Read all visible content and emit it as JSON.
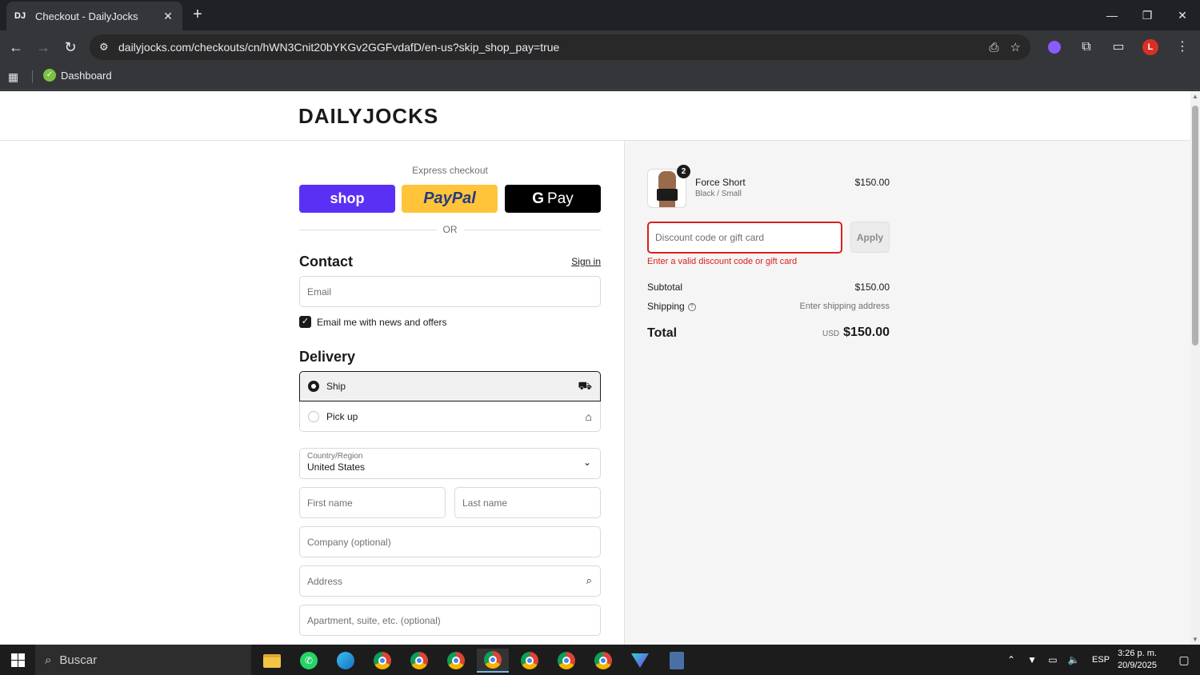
{
  "browser": {
    "tab": {
      "favicon": "DJ",
      "title": "Checkout - DailyJocks",
      "close": "✕"
    },
    "new_tab": "+",
    "window_controls": {
      "minimize": "—",
      "maximize": "❐",
      "close": "✕"
    },
    "url": "dailyjocks.com/checkouts/cn/hWN3Cnit20bYKGv2GGFvdafD/en-us?skip_shop_pay=true",
    "bookmarks": [
      {
        "label": "Dashboard"
      }
    ],
    "profile_initial": "L"
  },
  "site": {
    "logo": "DAILYJOCKS"
  },
  "checkout": {
    "express_label": "Express checkout",
    "express_buttons": {
      "shop": "shop",
      "paypal": "PayPal",
      "gpay_g": "G",
      "gpay_text": "Pay"
    },
    "or_text": "OR",
    "contact": {
      "title": "Contact",
      "sign_in": "Sign in",
      "email_placeholder": "Email",
      "newsletter_label": "Email me with news and offers",
      "newsletter_checked": true
    },
    "delivery": {
      "title": "Delivery",
      "options": [
        {
          "label": "Ship",
          "selected": true,
          "icon": "truck-icon"
        },
        {
          "label": "Pick up",
          "selected": false,
          "icon": "store-icon"
        }
      ],
      "country_label": "Country/Region",
      "country_value": "United States",
      "first_name_placeholder": "First name",
      "last_name_placeholder": "Last name",
      "company_placeholder": "Company (optional)",
      "address_placeholder": "Address",
      "apartment_placeholder": "Apartment, suite, etc. (optional)"
    }
  },
  "summary": {
    "product": {
      "name": "Force Short",
      "variant": "Black / Small",
      "price": "$150.00",
      "quantity": "2"
    },
    "discount_placeholder": "Discount code or gift card",
    "apply_label": "Apply",
    "discount_error": "Enter a valid discount code or gift card",
    "subtotal_label": "Subtotal",
    "subtotal_value": "$150.00",
    "shipping_label": "Shipping",
    "shipping_value": "Enter shipping address",
    "total_label": "Total",
    "total_currency": "USD",
    "total_value": "$150.00"
  },
  "taskbar": {
    "search_placeholder": "Buscar",
    "language": "ESP",
    "time": "3:26 p. m.",
    "date": "20/9/2025"
  },
  "colors": {
    "shop": "#5a31f4",
    "paypal": "#ffc439",
    "error": "#dd1d1d"
  }
}
